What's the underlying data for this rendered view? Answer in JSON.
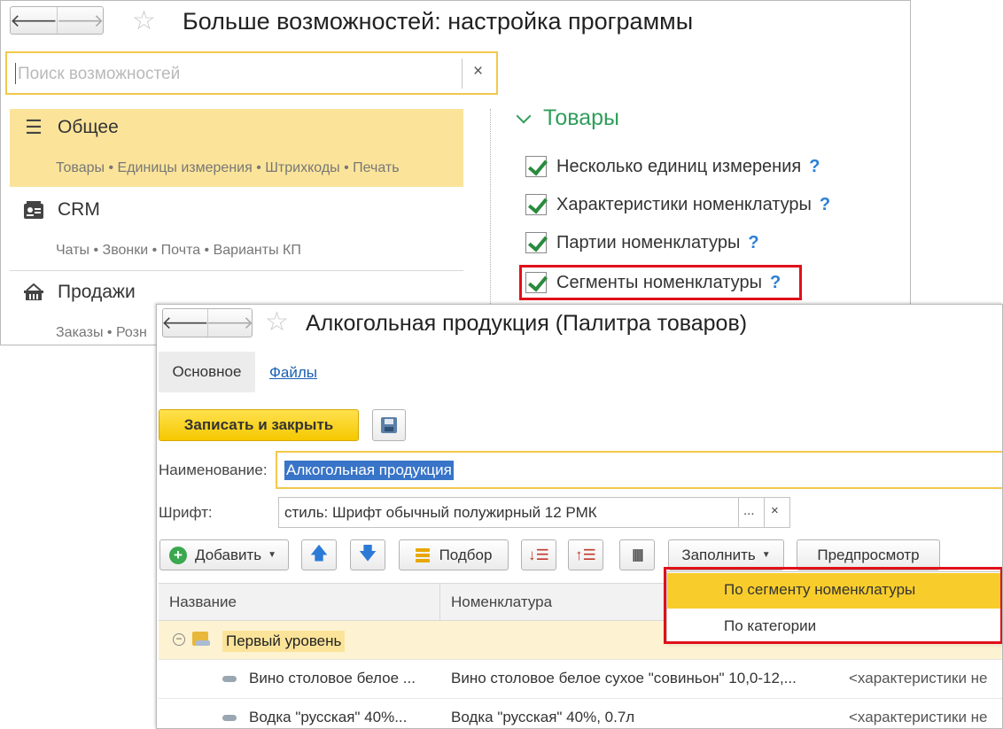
{
  "settings_window": {
    "title": "Больше возможностей: настройка программы",
    "search": {
      "placeholder": "Поиск возможностей",
      "clear": "×"
    },
    "sections": [
      {
        "label": "Общее",
        "icon": "list-icon",
        "subtitle": "Товары • Единицы измерения • Штрихкоды • Печать"
      },
      {
        "label": "CRM",
        "icon": "crm-card-icon",
        "subtitle": "Чаты • Звонки • Почта • Варианты КП"
      },
      {
        "label": "Продажи",
        "icon": "basket-icon",
        "subtitle": "Заказы • Розн"
      }
    ],
    "group_title": "Товары",
    "options": [
      {
        "label": "Несколько единиц измерения",
        "help": "?"
      },
      {
        "label": "Характеристики номенклатуры",
        "help": "?"
      },
      {
        "label": "Партии номенклатуры",
        "help": "?"
      },
      {
        "label": "Сегменты номенклатуры",
        "help": "?"
      }
    ]
  },
  "palette_window": {
    "title": "Алкогольная продукция (Палитра товаров)",
    "tabs": [
      "Основное",
      "Файлы"
    ],
    "save_close": "Записать и закрыть",
    "fields": {
      "name_label": "Наименование:",
      "name_value": "Алкогольная продукция",
      "font_label": "Шрифт:",
      "font_value": "стиль: Шрифт обычный полужирный 12 РМК",
      "font_select": "...",
      "font_clear": "×"
    },
    "toolbar": {
      "add": "Добавить",
      "pick": "Подбор",
      "fill": "Заполнить",
      "preview": "Предпросмотр"
    },
    "table": {
      "headers": [
        "Название",
        "Номенклатура"
      ],
      "group": "Первый уровень",
      "rows": [
        {
          "name": "Вино столовое белое ...",
          "nomenclature": "Вино столовое белое сухое \"совиньон\" 10,0-12,...",
          "characteristic": "<характеристики не"
        },
        {
          "name": "Водка \"русская\" 40%...",
          "nomenclature": "Водка \"русская\" 40%, 0.7л",
          "characteristic": "<характеристики не"
        }
      ]
    },
    "fill_menu": [
      "По сегменту номенклатуры",
      "По категории"
    ]
  },
  "colors": {
    "accent_yellow": "#f8cd2b",
    "highlight_red": "#e0101a",
    "group_green": "#2f9e5b"
  }
}
